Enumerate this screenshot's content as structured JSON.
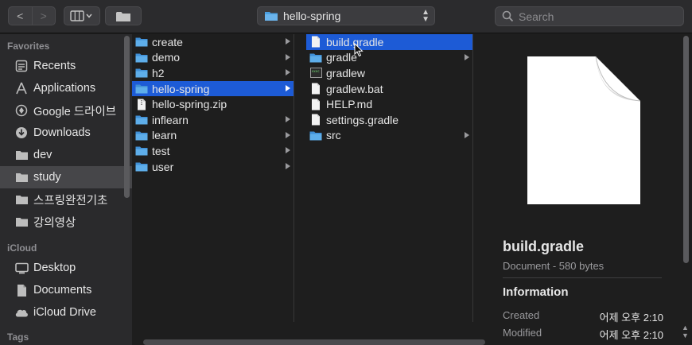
{
  "toolbar": {
    "back_label": "<",
    "forward_label": ">",
    "path_title": "hello-spring",
    "search_placeholder": "Search"
  },
  "sidebar": {
    "favorites_header": "Favorites",
    "favorites": [
      {
        "label": "Recents",
        "icon": "recents-icon"
      },
      {
        "label": "Applications",
        "icon": "applications-icon"
      },
      {
        "label": "Google 드라이브",
        "icon": "google-drive-icon"
      },
      {
        "label": "Downloads",
        "icon": "downloads-icon"
      },
      {
        "label": "dev",
        "icon": "folder-icon"
      },
      {
        "label": "study",
        "icon": "folder-icon",
        "selected": true
      },
      {
        "label": "스프링완전기초",
        "icon": "folder-icon"
      },
      {
        "label": "강의영상",
        "icon": "folder-icon"
      }
    ],
    "icloud_header": "iCloud",
    "icloud": [
      {
        "label": "Desktop",
        "icon": "desktop-icon"
      },
      {
        "label": "Documents",
        "icon": "documents-icon"
      },
      {
        "label": "iCloud Drive",
        "icon": "icloud-icon"
      }
    ],
    "tags_header": "Tags"
  },
  "column1": [
    {
      "label": "create",
      "type": "folder"
    },
    {
      "label": "demo",
      "type": "folder"
    },
    {
      "label": "h2",
      "type": "folder"
    },
    {
      "label": "hello-spring",
      "type": "folder",
      "selected": true
    },
    {
      "label": "hello-spring.zip",
      "type": "file"
    },
    {
      "label": "inflearn",
      "type": "folder"
    },
    {
      "label": "learn",
      "type": "folder"
    },
    {
      "label": "test",
      "type": "folder"
    },
    {
      "label": "user",
      "type": "folder"
    }
  ],
  "column2": [
    {
      "label": "build.gradle",
      "type": "file",
      "selected": true
    },
    {
      "label": "gradle",
      "type": "folder"
    },
    {
      "label": "gradlew",
      "type": "exec"
    },
    {
      "label": "gradlew.bat",
      "type": "file"
    },
    {
      "label": "HELP.md",
      "type": "file"
    },
    {
      "label": "settings.gradle",
      "type": "file"
    },
    {
      "label": "src",
      "type": "folder"
    }
  ],
  "preview": {
    "name": "build.gradle",
    "meta": "Document - 580 bytes",
    "info_header": "Information",
    "created_label": "Created",
    "created_value": "어제 오후 2:10",
    "modified_label": "Modified",
    "modified_value": "어제 오후 2:10"
  },
  "colors": {
    "selection": "#1d5bd6",
    "folder": "#4a9fe0"
  }
}
